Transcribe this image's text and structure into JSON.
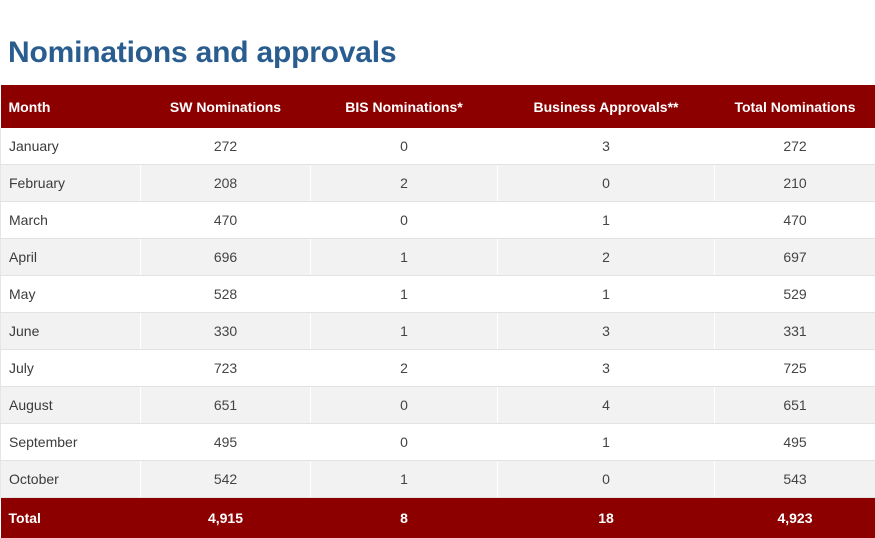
{
  "page": {
    "title": "Nominations and approvals"
  },
  "table": {
    "columns": [
      {
        "key": "month",
        "label": "Month",
        "align": "left"
      },
      {
        "key": "sw_nominations",
        "label": "SW Nominations",
        "align": "center"
      },
      {
        "key": "bis_nominations",
        "label": "BIS Nominations*",
        "align": "center"
      },
      {
        "key": "business_approvals",
        "label": "Business Approvals**",
        "align": "center"
      },
      {
        "key": "total_nominations",
        "label": "Total Nominations",
        "align": "center"
      }
    ],
    "rows": [
      {
        "month": "January",
        "sw_nominations": "272",
        "bis_nominations": "0",
        "business_approvals": "3",
        "total_nominations": "272"
      },
      {
        "month": "February",
        "sw_nominations": "208",
        "bis_nominations": "2",
        "business_approvals": "0",
        "total_nominations": "210"
      },
      {
        "month": "March",
        "sw_nominations": "470",
        "bis_nominations": "0",
        "business_approvals": "1",
        "total_nominations": "470"
      },
      {
        "month": "April",
        "sw_nominations": "696",
        "bis_nominations": "1",
        "business_approvals": "2",
        "total_nominations": "697"
      },
      {
        "month": "May",
        "sw_nominations": "528",
        "bis_nominations": "1",
        "business_approvals": "1",
        "total_nominations": "529"
      },
      {
        "month": "June",
        "sw_nominations": "330",
        "bis_nominations": "1",
        "business_approvals": "3",
        "total_nominations": "331"
      },
      {
        "month": "July",
        "sw_nominations": "723",
        "bis_nominations": "2",
        "business_approvals": "3",
        "total_nominations": "725"
      },
      {
        "month": "August",
        "sw_nominations": "651",
        "bis_nominations": "0",
        "business_approvals": "4",
        "total_nominations": "651"
      },
      {
        "month": "September",
        "sw_nominations": "495",
        "bis_nominations": "0",
        "business_approvals": "1",
        "total_nominations": "495"
      },
      {
        "month": "October",
        "sw_nominations": "542",
        "bis_nominations": "1",
        "business_approvals": "0",
        "total_nominations": "543"
      }
    ],
    "total_row": {
      "month": "Total",
      "sw_nominations": "4,915",
      "bis_nominations": "8",
      "business_approvals": "18",
      "total_nominations": "4,923"
    }
  },
  "colors": {
    "title": "#2a5d8f",
    "header_background": "#8c0000",
    "header_text": "#ffffff",
    "row_stripe": "#f2f2f2",
    "row_base": "#ffffff",
    "body_text": "#444444"
  }
}
